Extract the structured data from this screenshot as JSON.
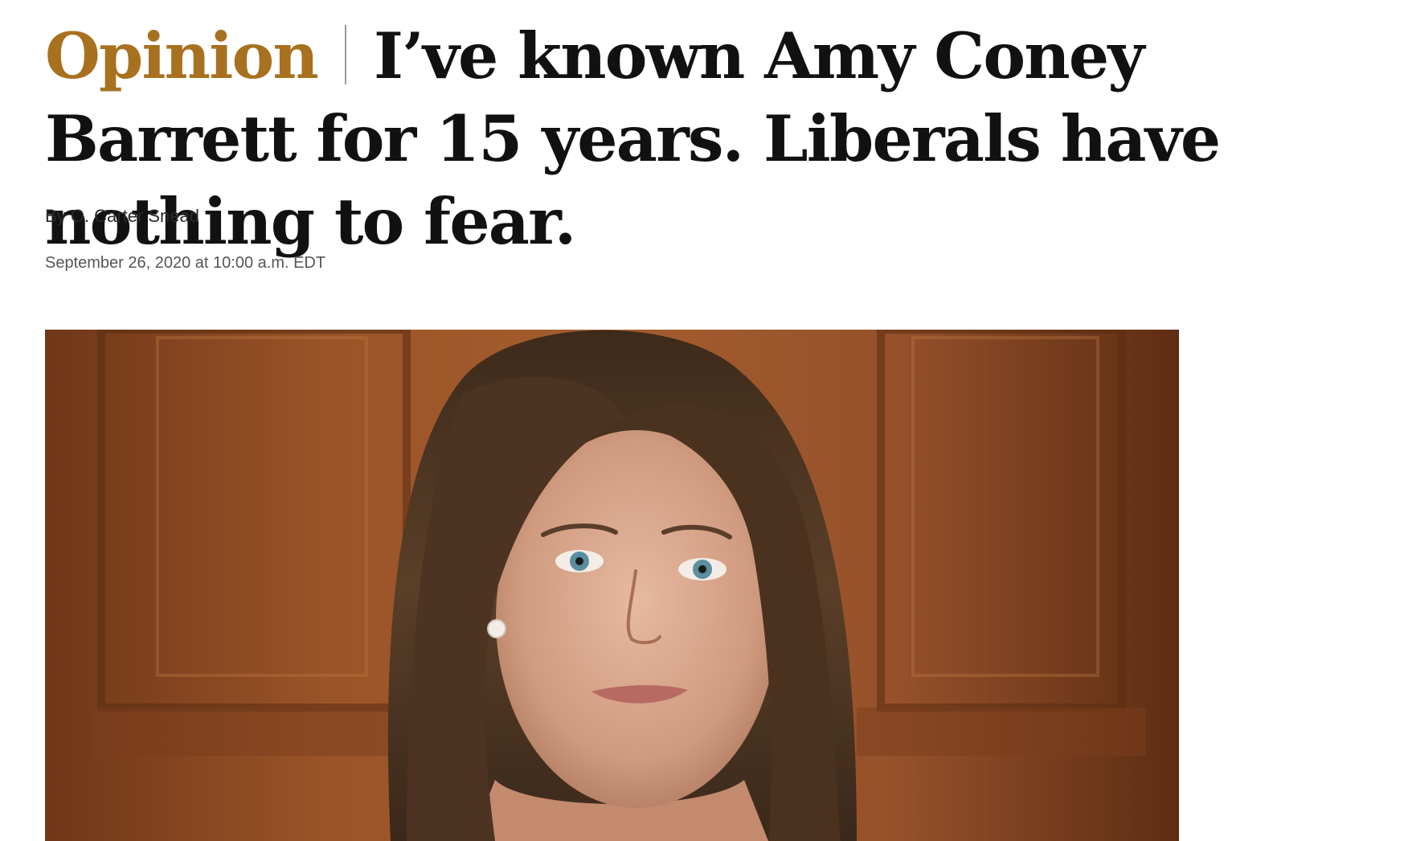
{
  "article": {
    "kicker": "Opinion",
    "headline": "I’ve known Amy Coney Barrett for 15 years. Liberals have nothing to fear.",
    "byline_prefix": "By",
    "author": "O. Carter Snead",
    "timestamp": "September 26, 2020 at 10:00 a.m. EDT"
  },
  "lead_image": {
    "subject": "portrait photo of a woman with long brown hair in front of wood paneling"
  },
  "colors": {
    "kicker": "#a8711f",
    "headline": "#111111",
    "wood": "#8a4a22"
  }
}
